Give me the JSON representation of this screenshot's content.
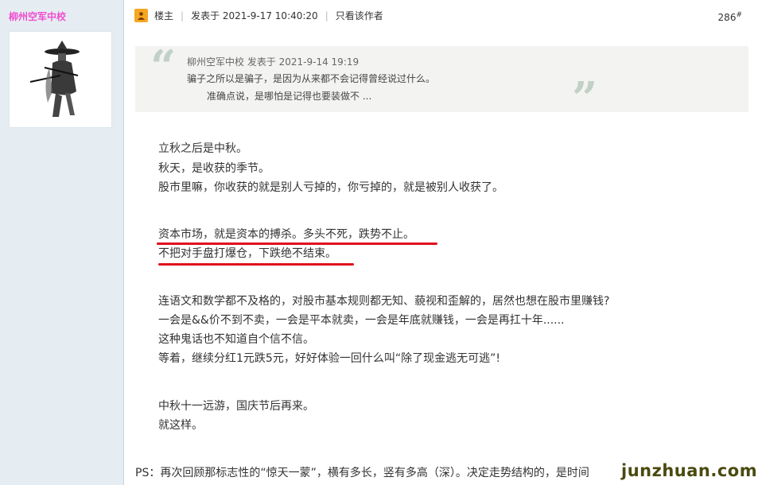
{
  "sidebar": {
    "author_name": "柳州空军中校"
  },
  "post_header": {
    "role": "楼主",
    "posted": "发表于 2021-9-17 10:40:20",
    "only_author": "只看该作者",
    "floor_number": "286",
    "floor_suffix": "#"
  },
  "quote": {
    "meta": "柳州空军中校 发表于 2021-9-14 19:19",
    "line1": "骗子之所以是骗子，是因为从来都不会记得曾经说过什么。",
    "line2": "准确点说，是哪怕是记得也要装做不 ..."
  },
  "body": {
    "p1": [
      "立秋之后是中秋。",
      "秋天，是收获的季节。",
      "股市里嘛，你收获的就是别人亏掉的，你亏掉的，就是被别人收获了。"
    ],
    "p2": [
      "资本市场，就是资本的搏杀。多头不死，跌势不止。",
      "不把对手盘打爆仓，下跌绝不结束。"
    ],
    "p3": [
      "连语文和数学都不及格的，对股市基本规则都无知、藐视和歪解的，居然也想在股市里赚钱?",
      "一会是&&价不到不卖，一会是平本就卖，一会是年底就赚钱，一会是再扛十年......",
      "这种鬼话也不知道自个信不信。",
      "等着，继续分红1元跌5元，好好体验一回什么叫“除了现金逃无可逃”!"
    ],
    "p4": [
      "中秋十一远游，国庆节后再来。",
      "就这样。"
    ]
  },
  "ps": "PS：再次回顾那标志性的“惊天一蒙”，横有多长，竖有多高（深）。决定走势结构的，是时间",
  "watermark_site": "junzhuan.com",
  "colors": {
    "author": "#f04ed0",
    "underline": "#e0101b",
    "sidebar_bg": "#e5edf2"
  }
}
